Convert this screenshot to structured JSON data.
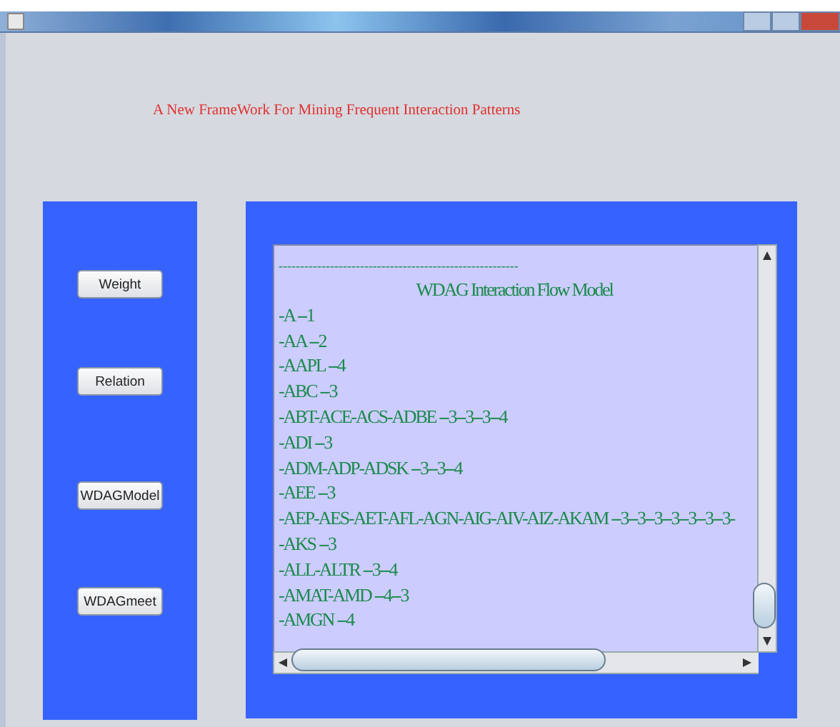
{
  "heading": "A New FrameWork For Mining Frequent Interaction Patterns",
  "buttons": [
    {
      "label": "Weight"
    },
    {
      "label": "Relation"
    },
    {
      "label": "WDAGModel"
    },
    {
      "label": "WDAGmeet"
    }
  ],
  "output": {
    "separator": "--------------------------------------------------------",
    "title": "WDAG Interaction Flow Model",
    "lines": [
      "-A --1",
      "-AA --2",
      "-AAPL --4",
      "-ABC --3",
      "-ABT-ACE-ACS-ADBE --3--3--3--4",
      "-ADI --3",
      "-ADM-ADP-ADSK --3--3--4",
      "-AEE --3",
      "-AEP-AES-AET-AFL-AGN-AIG-AIV-AIZ-AKAM --3--3--3--3--3--3--3-",
      "-AKS --3",
      "-ALL-ALTR --3--4",
      "-AMAT-AMD --4--3",
      "-AMGN --4"
    ]
  }
}
